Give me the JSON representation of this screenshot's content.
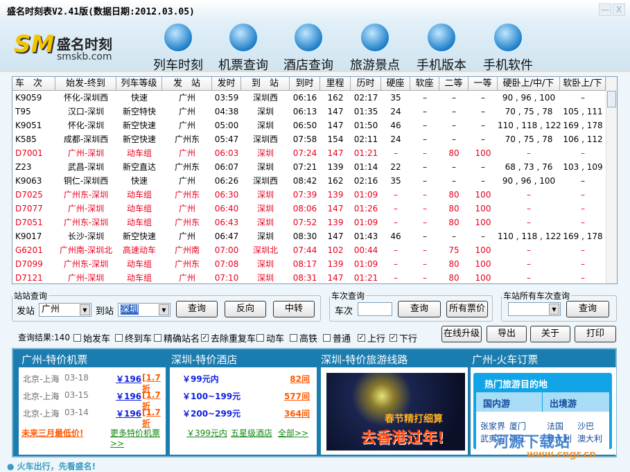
{
  "window": {
    "title": "盛名时刻表V2.41版(数据日期:2012.03.05)",
    "minimize": "—",
    "close": "X"
  },
  "logo": {
    "mark": "SM",
    "name": "盛名时刻",
    "url": "smskb.com"
  },
  "nav": [
    {
      "label": "列车时刻",
      "icon": "train-icon"
    },
    {
      "label": "机票查询",
      "icon": "plane-icon"
    },
    {
      "label": "酒店查询",
      "icon": "hotel-icon"
    },
    {
      "label": "旅游景点",
      "icon": "globe-icon"
    },
    {
      "label": "手机版本",
      "icon": "windows-icon"
    },
    {
      "label": "手机软件",
      "icon": "java-icon"
    }
  ],
  "table": {
    "columns": [
      "车　次",
      "始发-终到",
      "列车等级",
      "发　站",
      "发时",
      "到　站",
      "到时",
      "里程",
      "历时",
      "硬座",
      "软座",
      "二等",
      "一等",
      "硬卧上/中/下",
      "软卧上/下"
    ],
    "rows": [
      {
        "red": false,
        "cells": [
          "K9059",
          "怀化-深圳西",
          "快速",
          "广州",
          "03:59",
          "深圳西",
          "06:16",
          "162",
          "02:17",
          "35",
          "–",
          "–",
          "–",
          "90 , 96 , 100",
          "–"
        ]
      },
      {
        "red": false,
        "cells": [
          "T95",
          "汉口-深圳",
          "新空特快",
          "广州",
          "04:38",
          "深圳",
          "06:13",
          "147",
          "01:35",
          "24",
          "–",
          "–",
          "–",
          "70 , 75 , 78",
          "105 , 111"
        ]
      },
      {
        "red": false,
        "cells": [
          "K9051",
          "怀化-深圳",
          "新空快速",
          "广州",
          "05:00",
          "深圳",
          "06:50",
          "147",
          "01:50",
          "46",
          "–",
          "–",
          "–",
          "110 , 118 , 122",
          "169 , 178"
        ]
      },
      {
        "red": false,
        "cells": [
          "K585",
          "成都-深圳西",
          "新空快速",
          "广州东",
          "05:47",
          "深圳西",
          "07:58",
          "154",
          "02:11",
          "24",
          "–",
          "–",
          "–",
          "70 , 75 , 78",
          "106 , 112"
        ]
      },
      {
        "red": true,
        "cells": [
          "D7001",
          "广州-深圳",
          "动车组",
          "广州",
          "06:03",
          "深圳",
          "07:24",
          "147",
          "01:21",
          "–",
          "–",
          "80",
          "100",
          "–",
          "–"
        ]
      },
      {
        "red": false,
        "cells": [
          "Z23",
          "武昌-深圳",
          "新空直达",
          "广州东",
          "06:07",
          "深圳",
          "07:21",
          "139",
          "01:14",
          "22",
          "–",
          "–",
          "–",
          "68 , 73 , 76",
          "103 , 109"
        ]
      },
      {
        "red": false,
        "cells": [
          "K9063",
          "铜仁-深圳西",
          "快速",
          "广州",
          "06:26",
          "深圳西",
          "08:42",
          "162",
          "02:16",
          "35",
          "–",
          "–",
          "–",
          "90 , 96 , 100",
          "–"
        ]
      },
      {
        "red": true,
        "cells": [
          "D7025",
          "广州东-深圳",
          "动车组",
          "广州东",
          "06:30",
          "深圳",
          "07:39",
          "139",
          "01:09",
          "–",
          "–",
          "80",
          "100",
          "–",
          "–"
        ]
      },
      {
        "red": true,
        "cells": [
          "D7077",
          "广州-深圳",
          "动车组",
          "广州",
          "06:40",
          "深圳",
          "08:06",
          "147",
          "01:26",
          "–",
          "–",
          "80",
          "100",
          "–",
          "–"
        ]
      },
      {
        "red": true,
        "cells": [
          "D7051",
          "广州东-深圳",
          "动车组",
          "广州东",
          "06:43",
          "深圳",
          "07:52",
          "139",
          "01:09",
          "–",
          "–",
          "80",
          "100",
          "–",
          "–"
        ]
      },
      {
        "red": false,
        "cells": [
          "K9017",
          "长沙-深圳",
          "新空快速",
          "广州",
          "06:47",
          "深圳",
          "08:30",
          "147",
          "01:43",
          "46",
          "–",
          "–",
          "–",
          "110 , 118 , 122",
          "169 , 178"
        ]
      },
      {
        "red": true,
        "cells": [
          "G6201",
          "广州南-深圳北",
          "高速动车",
          "广州南",
          "07:00",
          "深圳北",
          "07:44",
          "102",
          "00:44",
          "–",
          "–",
          "75",
          "100",
          "–",
          "–"
        ]
      },
      {
        "red": true,
        "cells": [
          "D7099",
          "广州东-深圳",
          "动车组",
          "广州东",
          "07:08",
          "深圳",
          "08:17",
          "139",
          "01:09",
          "–",
          "–",
          "80",
          "100",
          "–",
          "–"
        ]
      },
      {
        "red": true,
        "cells": [
          "D7121",
          "广州-深圳",
          "动车组",
          "广州",
          "07:10",
          "深圳",
          "08:31",
          "147",
          "01:21",
          "–",
          "–",
          "80",
          "100",
          "–",
          "–"
        ]
      }
    ]
  },
  "station_query": {
    "legend": "站站查询",
    "from_label": "发站",
    "from_value": "广州",
    "to_label": "到站",
    "to_value": "深圳",
    "query": "查询",
    "reverse": "反向",
    "transfer": "中转"
  },
  "train_query": {
    "legend": "车次查询",
    "label": "车次",
    "value": "",
    "query": "查询",
    "all_prices": "所有票价"
  },
  "station_all": {
    "legend": "车站所有车次查询",
    "value": "",
    "query": "查询"
  },
  "filters": {
    "result": "查询结果:140",
    "items": [
      {
        "label": "始发车",
        "checked": false
      },
      {
        "label": "终到车",
        "checked": false
      },
      {
        "label": "精确站名",
        "checked": false
      },
      {
        "label": "去除重复车",
        "checked": true
      },
      {
        "label": "动车",
        "checked": false
      },
      {
        "label": "高铁",
        "checked": false
      },
      {
        "label": "普通",
        "checked": false
      },
      {
        "label": "上行",
        "checked": true
      },
      {
        "label": "下行",
        "checked": true
      }
    ]
  },
  "actions": {
    "upgrade": "在线升级",
    "export": "导出",
    "about": "关于",
    "print": "打印"
  },
  "ads": {
    "flights": {
      "title": "广州-特价机票",
      "items": [
        {
          "route": "北京-上海",
          "date": "03-18",
          "price": "￥196",
          "discount": "[1.7折"
        },
        {
          "route": "北京-上海",
          "date": "03-15",
          "price": "￥196",
          "discount": "[1.7折"
        },
        {
          "route": "北京-上海",
          "date": "03-14",
          "price": "￥196",
          "discount": "[1.7折"
        }
      ],
      "lowest": "未来三月最低价!",
      "more": "更多特价机票>>"
    },
    "hotels": {
      "title": "深圳-特价酒店",
      "items": [
        {
          "range": "￥99元内",
          "count": "82间"
        },
        {
          "range": "￥100~199元",
          "count": "577间"
        },
        {
          "range": "￥200~299元",
          "count": "364间"
        }
      ],
      "links": [
        "￥399元内",
        "五星级酒店",
        "全部>>"
      ]
    },
    "tours": {
      "title": "深圳-特价旅游线路",
      "banner_top": "春节精打细算",
      "banner_main": "去香港过年!"
    },
    "trains": {
      "title": "广州-火车订票",
      "box_title": "热门旅游目的地",
      "domestic": "国内游",
      "abroad": "出境游",
      "domestic_items": [
        "张家界",
        "厦门",
        "武夷山",
        "丽江"
      ],
      "abroad_items": [
        "法国",
        "沙巴",
        "意大利",
        "澳大利"
      ]
    }
  },
  "watermark": {
    "name": "河源下载站",
    "url": "www.cngr.cn"
  },
  "footer": "火车出行，先看盛名!"
}
